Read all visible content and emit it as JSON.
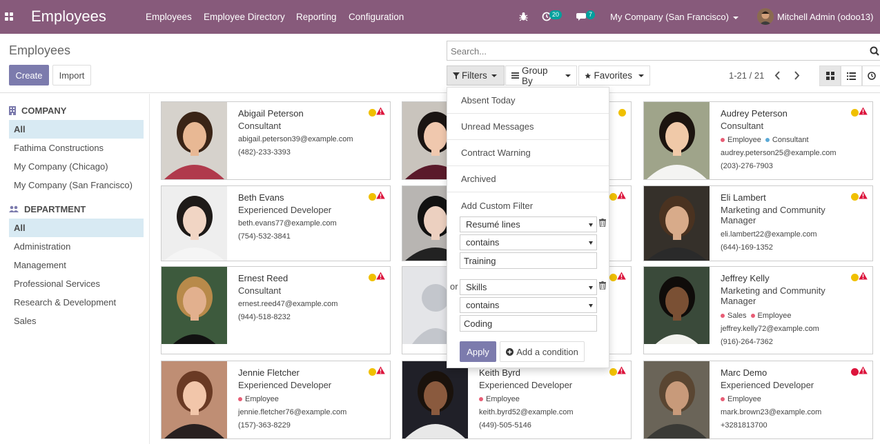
{
  "navbar": {
    "app_title": "Employees",
    "menu": [
      "Employees",
      "Employee Directory",
      "Reporting",
      "Configuration"
    ],
    "activity_count": "20",
    "messages_count": "7",
    "company": "My Company (San Francisco)",
    "user": "Mitchell Admin (odoo13)"
  },
  "control_panel": {
    "breadcrumb": "Employees",
    "create_label": "Create",
    "import_label": "Import",
    "search_placeholder": "Search...",
    "filters_label": "Filters",
    "groupby_label": "Group By",
    "favorites_label": "Favorites",
    "pager": "1-21 / 21"
  },
  "sidebar": {
    "company_heading": "COMPANY",
    "companies": [
      "All",
      "Fathima Constructions",
      "My Company (Chicago)",
      "My Company (San Francisco)"
    ],
    "department_heading": "DEPARTMENT",
    "departments": [
      "All",
      "Administration",
      "Management",
      "Professional Services",
      "Research & Development",
      "Sales"
    ]
  },
  "filters_dropdown": {
    "items": [
      "Absent Today",
      "Unread Messages",
      "Contract Warning",
      "Archived"
    ],
    "custom_filter_label": "Add Custom Filter",
    "condition1": {
      "field": "Resumé lines",
      "operator": "contains",
      "value": "Training"
    },
    "or_label": "or",
    "condition2": {
      "field": "Skills",
      "operator": "contains",
      "value": "Coding"
    },
    "apply_label": "Apply",
    "add_condition_label": "Add a condition"
  },
  "employees": [
    {
      "name": "Abigail Peterson",
      "job": "Consultant",
      "tags": [],
      "email": "abigail.peterson39@example.com",
      "phone": "(482)-233-3393"
    },
    {
      "name": "",
      "job": "",
      "tags": [],
      "email": "",
      "phone": ""
    },
    {
      "name": "Audrey Peterson",
      "job": "Consultant",
      "tags": [
        {
          "label": "Employee",
          "color": "#e85d75"
        },
        {
          "label": "Consultant",
          "color": "#5aa9d6"
        }
      ],
      "email": "audrey.peterson25@example.com",
      "phone": "(203)-276-7903"
    },
    {
      "name": "Beth Evans",
      "job": "Experienced Developer",
      "tags": [],
      "email": "beth.evans77@example.com",
      "phone": "(754)-532-3841"
    },
    {
      "name": "",
      "job": "",
      "tags": [],
      "email": "",
      "phone": ""
    },
    {
      "name": "Eli Lambert",
      "job": "Marketing and Community Manager",
      "tags": [],
      "email": "eli.lambert22@example.com",
      "phone": "(644)-169-1352"
    },
    {
      "name": "Ernest Reed",
      "job": "Consultant",
      "tags": [],
      "email": "ernest.reed47@example.com",
      "phone": "(944)-518-8232"
    },
    {
      "name": "",
      "job": "",
      "tags": [],
      "email": "",
      "phone": ""
    },
    {
      "name": "Jeffrey Kelly",
      "job": "Marketing and Community Manager",
      "tags": [
        {
          "label": "Sales",
          "color": "#e85d75"
        },
        {
          "label": "Employee",
          "color": "#e85d75"
        }
      ],
      "email": "jeffrey.kelly72@example.com",
      "phone": "(916)-264-7362"
    },
    {
      "name": "Jennie Fletcher",
      "job": "Experienced Developer",
      "tags": [
        {
          "label": "Employee",
          "color": "#e85d75"
        }
      ],
      "email": "jennie.fletcher76@example.com",
      "phone": "(157)-363-8229"
    },
    {
      "name": "Keith Byrd",
      "job": "Experienced Developer",
      "tags": [
        {
          "label": "Employee",
          "color": "#e85d75"
        }
      ],
      "email": "keith.byrd52@example.com",
      "phone": "(449)-505-5146"
    },
    {
      "name": "Marc Demo",
      "job": "Experienced Developer",
      "tags": [
        {
          "label": "Employee",
          "color": "#e85d75"
        }
      ],
      "email": "mark.brown23@example.com",
      "phone": "+3281813700"
    }
  ],
  "colors": {
    "brand": "#875a7b",
    "primary": "#7c7bad",
    "status_yellow": "#f0c000",
    "status_red": "#dc143c",
    "warning_red": "#dc143c",
    "sidebar_active": "#d8eaf3"
  }
}
